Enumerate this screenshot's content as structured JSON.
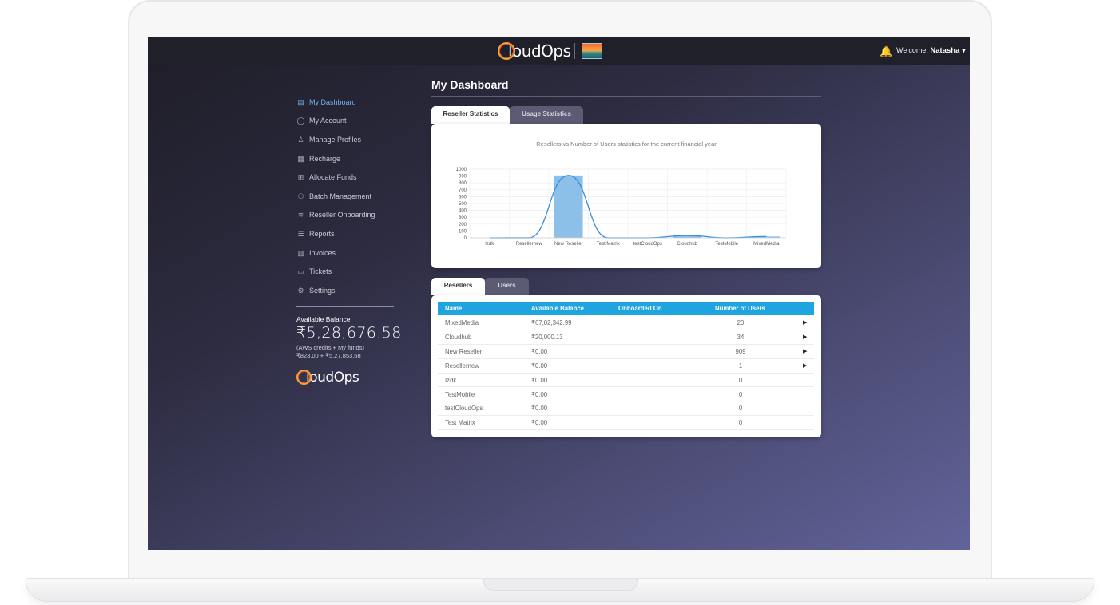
{
  "header": {
    "logo_first": "C",
    "logo_rest": "loudOps",
    "welcome_prefix": "Welcome,",
    "user_name": "Natasha ▾"
  },
  "sidebar": {
    "items": [
      {
        "label": "My Dashboard",
        "icon": "dashboard-icon",
        "active": true
      },
      {
        "label": "My Account",
        "icon": "user-icon"
      },
      {
        "label": "Manage Profiles",
        "icon": "profiles-icon"
      },
      {
        "label": "Recharge",
        "icon": "recharge-icon"
      },
      {
        "label": "Allocate Funds",
        "icon": "funds-icon"
      },
      {
        "label": "Batch Management",
        "icon": "batch-icon"
      },
      {
        "label": "Reseller Onboarding",
        "icon": "onboarding-icon"
      },
      {
        "label": "Reports",
        "icon": "reports-icon"
      },
      {
        "label": "Invoices",
        "icon": "invoices-icon"
      },
      {
        "label": "Tickets",
        "icon": "tickets-icon"
      },
      {
        "label": "Settings",
        "icon": "settings-icon"
      }
    ],
    "balance_label": "Available Balance",
    "balance_amount": "₹5,28,676.58",
    "balance_note_1": "(AWS credits + My funds)",
    "balance_note_2": "₹823.00 + ₹5,27,853.58",
    "logo_first": "C",
    "logo_rest": "loudOps"
  },
  "main": {
    "title": "My Dashboard",
    "chart_tabs": [
      "Reseller Statistics",
      "Usage Statistics"
    ],
    "table_tabs": [
      "Resellers",
      "Users"
    ]
  },
  "chart_data": {
    "type": "bar",
    "title": "Resellers vs Number of Users statistics for the current financial year",
    "categories": [
      "Izdk",
      "Resellernew",
      "New Reseller",
      "Test Matrix",
      "testCloudOps",
      "Cloudhub",
      "TestMobile",
      "MixedMedia"
    ],
    "values": [
      0,
      1,
      909,
      0,
      0,
      34,
      0,
      20
    ],
    "ylim": [
      0,
      1000
    ],
    "yticks": [
      0,
      100,
      200,
      300,
      400,
      500,
      600,
      700,
      800,
      900,
      1000
    ],
    "series_overlay": "smoothed line",
    "grid": true,
    "colors": {
      "bar": "#8cc0e8",
      "line": "#3a8fd6"
    }
  },
  "table": {
    "columns": [
      "Name",
      "Available Balance",
      "Onboarded On",
      "Number of Users"
    ],
    "rows": [
      {
        "name": "MixedMedia",
        "balance": "₹67,02,342.99",
        "onboarded": "",
        "users": "20",
        "expand": "▶"
      },
      {
        "name": "Cloudhub",
        "balance": "₹20,000.13",
        "onboarded": "",
        "users": "34",
        "expand": "▶"
      },
      {
        "name": "New Reseller",
        "balance": "₹0.00",
        "onboarded": "",
        "users": "909",
        "expand": "▶"
      },
      {
        "name": "Resellernew",
        "balance": "₹0.00",
        "onboarded": "",
        "users": "1",
        "expand": "▶"
      },
      {
        "name": "Izdk",
        "balance": "₹0.00",
        "onboarded": "",
        "users": "0",
        "expand": ""
      },
      {
        "name": "TestMobile",
        "balance": "₹0.00",
        "onboarded": "",
        "users": "0",
        "expand": ""
      },
      {
        "name": "testCloudOps",
        "balance": "₹0.00",
        "onboarded": "",
        "users": "0",
        "expand": ""
      },
      {
        "name": "Test Matrix",
        "balance": "₹0.00",
        "onboarded": "",
        "users": "0",
        "expand": ""
      }
    ]
  },
  "colors": {
    "accent": "#1ea5e0",
    "active_nav": "#6fb2ee",
    "logo_ring": "#f2a23a"
  }
}
